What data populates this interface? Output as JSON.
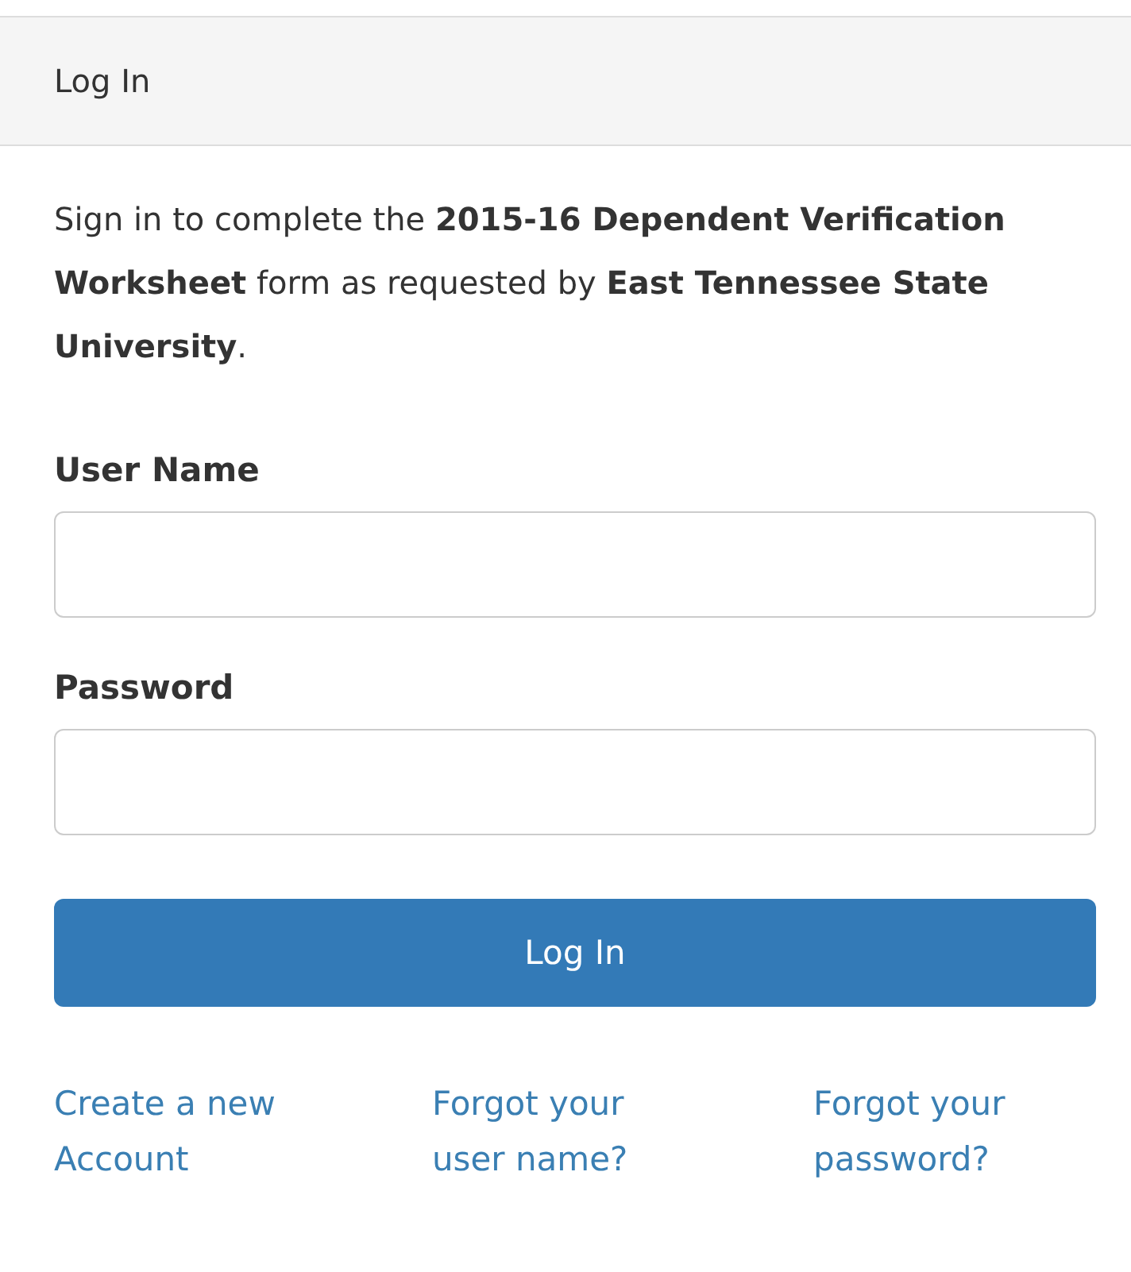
{
  "panel": {
    "title": "Log In"
  },
  "intro": "Sign in to complete the **2015-16 Dependent Verification Worksheet** form as requested by **East Tennessee State University**.",
  "fields": [
    {
      "label": "User Name"
    },
    {
      "label": "Password"
    }
  ],
  "submit": "Log In",
  "links": [
    "Create a new Account",
    "Forgot your user name?",
    "Forgot your password?"
  ]
}
